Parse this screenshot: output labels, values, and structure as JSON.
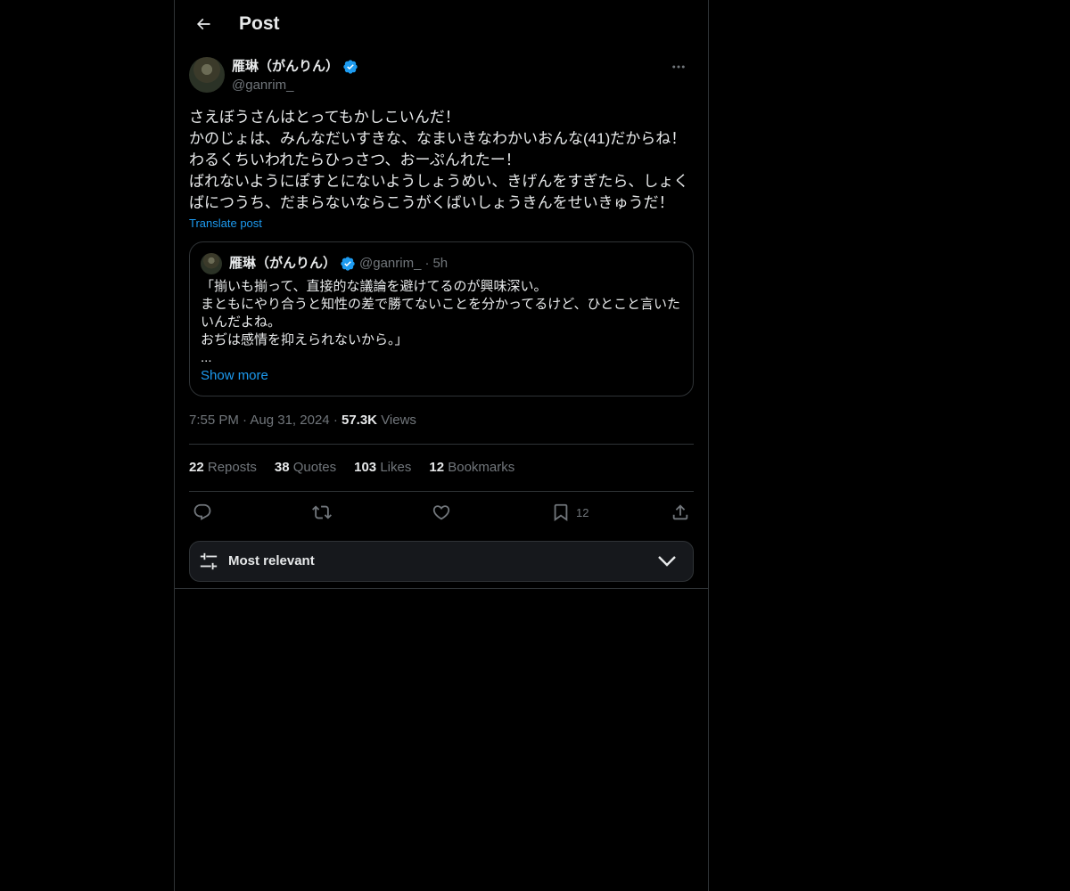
{
  "header": {
    "title": "Post",
    "back_icon": "arrow-left-icon"
  },
  "post": {
    "author": {
      "display_name": "雁琳（がんりん）",
      "handle": "@ganrim_",
      "verified": true
    },
    "text_lines": [
      "さえぼうさんはとってもかしこいんだ！",
      "かのじょは、みんなだいすきな、なまいきなわかいおんな(41)だからね！",
      "わるくちいわれたらひっさつ、おーぷんれたー！",
      "ばれないようにぽすとにないようしょうめい、きげんをすぎたら、しょく",
      "ばにつうち、だまらないならこうがくばいしょうきんをせいきゅうだ！"
    ],
    "translate_label": "Translate post",
    "quote": {
      "display_name": "雁琳（がんりん）",
      "handle": "@ganrim_",
      "separator": "·",
      "time": "5h",
      "body_lines": [
        "「揃いも揃って、直接的な議論を避けてるのが興味深い。",
        "まともにやり合うと知性の差で勝てないことを分かってるけど、ひとこと言いた",
        "いんだよね。",
        "おぢは感情を抑えられないから。」",
        "..."
      ],
      "show_more_label": "Show more"
    },
    "meta": {
      "time": "7:55 PM",
      "date": "Aug 31, 2024",
      "separator": "·",
      "views_count": "57.3K",
      "views_label": "Views"
    },
    "stats": [
      {
        "count": "22",
        "label": "Reposts"
      },
      {
        "count": "38",
        "label": "Quotes"
      },
      {
        "count": "103",
        "label": "Likes"
      },
      {
        "count": "12",
        "label": "Bookmarks"
      }
    ],
    "actions": {
      "reply_icon": "reply-icon",
      "repost_icon": "repost-icon",
      "like_icon": "heart-icon",
      "bookmark_icon": "bookmark-icon",
      "bookmark_count": "12",
      "share_icon": "share-icon"
    }
  },
  "replies_sort": {
    "label": "Most relevant",
    "icon": "sliders-icon",
    "chevron": "chevron-down-icon"
  },
  "colors": {
    "background": "#000000",
    "text": "#e7e9ea",
    "secondary": "#71767b",
    "accent": "#1d9bf0",
    "border": "#2f3336"
  }
}
